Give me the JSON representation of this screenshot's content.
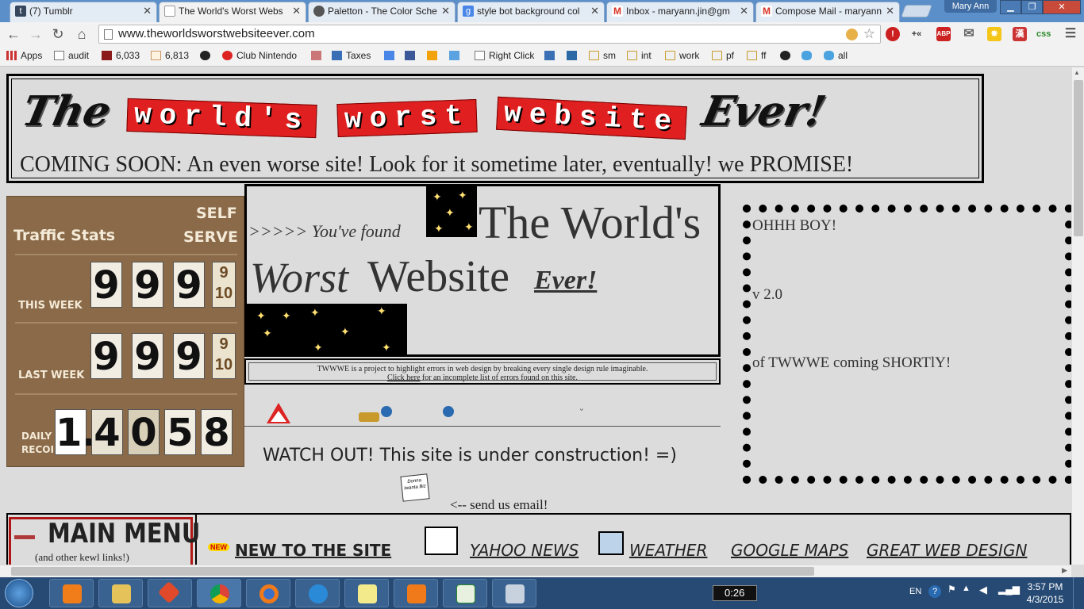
{
  "browser": {
    "tabs": [
      {
        "title": "(7) Tumblr",
        "color": "#36465d",
        "fav": "t"
      },
      {
        "title": "The World's Worst Webs",
        "color": "#ffffff",
        "fav": ""
      },
      {
        "title": "Paletton - The Color Sche",
        "color": "#555555",
        "fav": ""
      },
      {
        "title": "style bot background col",
        "color": "#4a86e8",
        "fav": "g"
      },
      {
        "title": "Inbox - maryann.jin@gm",
        "color": "#d93025",
        "fav": "M"
      },
      {
        "title": "Compose Mail - maryann",
        "color": "#d93025",
        "fav": "M"
      }
    ],
    "user_label": "Mary Ann",
    "url": "www.theworldsworstwebsiteever.com",
    "extensions": {
      "abp": "ABP",
      "css": "css"
    },
    "bookmarks": [
      {
        "label": "Apps"
      },
      {
        "label": "audit"
      },
      {
        "label": "6,033"
      },
      {
        "label": "6,813"
      },
      {
        "label": ""
      },
      {
        "label": "Club Nintendo"
      },
      {
        "label": ""
      },
      {
        "label": "Taxes"
      },
      {
        "label": "Right Click"
      },
      {
        "label": "sm"
      },
      {
        "label": "int"
      },
      {
        "label": "work"
      },
      {
        "label": "pf"
      },
      {
        "label": "ff"
      },
      {
        "label": "all"
      }
    ]
  },
  "page": {
    "banner": {
      "the": "The",
      "worlds": "world's",
      "worst": "worst",
      "website": "website",
      "ever": "Ever!",
      "coming_soon": "COMING SOON: An even worse site! Look for it sometime later, eventually!  we PROMISE!"
    },
    "stats": {
      "title": "Traffic Stats",
      "self": "SELF",
      "serve": "SERVE",
      "rows": [
        {
          "label": "THIS WEEK",
          "digits": [
            "9",
            "9",
            "9"
          ],
          "frac_top": "9",
          "frac_bottom": "10"
        },
        {
          "label": "LAST WEEK",
          "digits": [
            "9",
            "9",
            "9"
          ],
          "frac_top": "9",
          "frac_bottom": "10"
        },
        {
          "label": "DAILY RECORD",
          "digits": [
            "1.",
            "4",
            "0",
            "5",
            "8"
          ]
        }
      ]
    },
    "found": {
      "prefix": ">>>>> You've found",
      "the_worlds": "The World's",
      "worst": "Worst",
      "website": "Website",
      "ever": "Ever!"
    },
    "desc": {
      "line1": "TWWWE is a project to highlight errors in web design by breaking every single design rule imaginable.",
      "link": "Click here",
      "line2": " for an incomplete list of errors found on this site."
    },
    "watch_out": "WATCH OUT!  This site is under construction! =)",
    "email_icon_text": "Donna Iwanta Biz",
    "send_email": "<-- send us email!",
    "ohhh": {
      "line1": "OHHH BOY!",
      "line2": "v 2.0",
      "line3": "of TWWWE coming SHORTlY!"
    },
    "menu": {
      "title": "MAIN MENU",
      "subtitle": "(and other kewl links!)",
      "new_badge": "NEW",
      "links": [
        "NEW TO THE SITE",
        "YAHOO NEWS",
        "WEATHER",
        "GOOGLE MAPS",
        "GREAT WEB DESIGN"
      ]
    }
  },
  "taskbar": {
    "timer": "0:26",
    "lang": "EN",
    "time": "3:57 PM",
    "date": "4/3/2015"
  }
}
